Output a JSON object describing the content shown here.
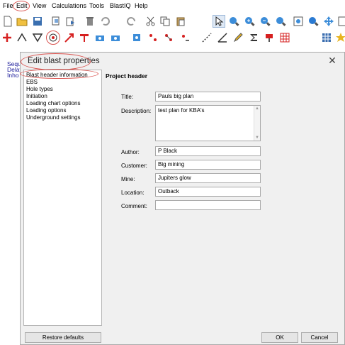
{
  "menu": {
    "items": [
      "File",
      "Edit",
      "View",
      "Calculations",
      "Tools",
      "BlastIQ",
      "Help"
    ]
  },
  "background": {
    "lines": [
      "Sequ",
      "Delay",
      "Inho"
    ]
  },
  "dialog": {
    "title": "Edit blast properties",
    "close_glyph": "✕",
    "nav": [
      "Blast header information",
      "EBS",
      "Hole types",
      "Initiation",
      "Loading chart options",
      "Loading options",
      "Underground settings"
    ],
    "section_title": "Project header",
    "fields": {
      "title_label": "Title:",
      "title_value": "Pauls big plan",
      "description_label": "Description:",
      "description_value": "test plan for KBA's",
      "author_label": "Author:",
      "author_value": "P Black",
      "customer_label": "Customer:",
      "customer_value": "Big mining",
      "mine_label": "Mine:",
      "mine_value": "Jupiters glow",
      "location_label": "Location:",
      "location_value": "Outback",
      "comment_label": "Comment:",
      "comment_value": ""
    },
    "buttons": {
      "restore": "Restore defaults",
      "ok": "OK",
      "cancel": "Cancel"
    }
  },
  "colors": {
    "highlight_circle": "#d9534f",
    "dialog_bg": "#f0f0f0"
  },
  "toolbar_icons": [
    "new-file-icon",
    "open-folder-icon",
    "save-icon",
    "copy-page-icon",
    "export-icon",
    "delete-icon",
    "undo-icon",
    "redo-icon",
    "cut-icon",
    "copy-icon",
    "paste-icon",
    "pointer-icon",
    "zoom-in-icon",
    "zoom-out-icon",
    "zoom-fit-icon",
    "zoom-window-icon",
    "pan-icon",
    "add-point-icon",
    "polyline-icon",
    "triangle-icon",
    "target-icon",
    "arrow-icon",
    "text-icon",
    "camera-icon",
    "hole-icon",
    "grid-icon",
    "table-icon"
  ]
}
